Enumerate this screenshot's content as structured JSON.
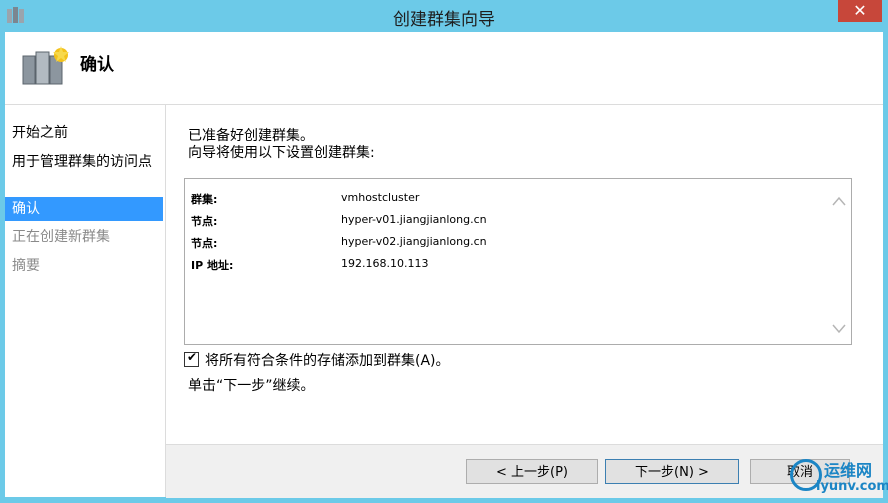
{
  "window": {
    "title": "创建群集向导",
    "close_label": "✕"
  },
  "header": {
    "title": "确认"
  },
  "sidebar": {
    "items": [
      {
        "label": "开始之前",
        "state": "normal"
      },
      {
        "label": "用于管理群集的访问点",
        "state": "normal"
      },
      {
        "label": "确认",
        "state": "active"
      },
      {
        "label": "正在创建新群集",
        "state": "disabled"
      },
      {
        "label": "摘要",
        "state": "disabled"
      }
    ]
  },
  "content": {
    "intro_line1": "已准备好创建群集。",
    "intro_line2": "向导将使用以下设置创建群集:",
    "settings": [
      {
        "key": "群集:",
        "value": "vmhostcluster"
      },
      {
        "key": "节点:",
        "value": "hyper-v01.jiangjianlong.cn"
      },
      {
        "key": "节点:",
        "value": "hyper-v02.jiangjianlong.cn"
      },
      {
        "key": "IP 地址:",
        "value": "192.168.10.113"
      }
    ],
    "checkbox_label": "将所有符合条件的存储添加到群集(A)。",
    "checkbox_checked": true,
    "hint": "单击“下一步”继续。"
  },
  "footer": {
    "prev_label": "< 上一步(P)",
    "next_label": "下一步(N) >",
    "cancel_label": "取消"
  },
  "watermark": {
    "line1": "运维网",
    "line2": "iyunv.com"
  },
  "colors": {
    "titlebar": "#6ccae8",
    "active": "#3399ff",
    "close": "#c7473a"
  }
}
